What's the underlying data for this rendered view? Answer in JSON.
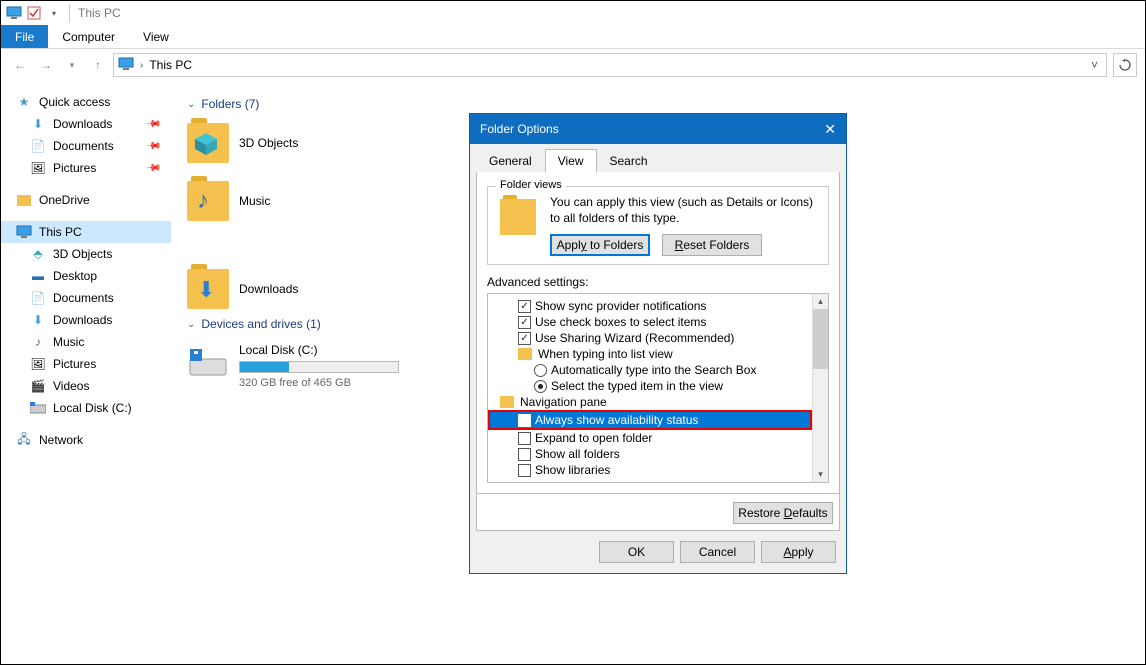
{
  "titlebar": {
    "title": "This PC"
  },
  "ribbon": {
    "file": "File",
    "computer": "Computer",
    "view": "View"
  },
  "address": {
    "text": "This PC"
  },
  "sidebar": {
    "quick": "Quick access",
    "downloads": "Downloads",
    "documents": "Documents",
    "pictures": "Pictures",
    "onedrive": "OneDrive",
    "thispc": "This PC",
    "objects3d": "3D Objects",
    "desktop": "Desktop",
    "docs2": "Documents",
    "dl2": "Downloads",
    "music": "Music",
    "pics2": "Pictures",
    "videos": "Videos",
    "localdisk": "Local Disk (C:)",
    "network": "Network"
  },
  "content": {
    "folders_header": "Folders (7)",
    "drives_header": "Devices and drives (1)",
    "folders": {
      "a": "3D Objects",
      "b": "Music",
      "c": "Downloads"
    },
    "disk": {
      "name": "Local Disk (C:)",
      "free": "320 GB free of 465 GB"
    }
  },
  "dialog": {
    "title": "Folder Options",
    "tabs": {
      "general": "General",
      "view": "View",
      "search": "Search"
    },
    "fv": {
      "legend": "Folder views",
      "desc": "You can apply this view (such as Details or Icons) to all folders of this type.",
      "apply": "Apply to Folders",
      "reset": "Reset Folders"
    },
    "adv_label": "Advanced settings:",
    "adv": {
      "a1": "Show sync provider notifications",
      "a2": "Use check boxes to select items",
      "a3": "Use Sharing Wizard (Recommended)",
      "a4": "When typing into list view",
      "a5": "Automatically type into the Search Box",
      "a6": "Select the typed item in the view",
      "a7": "Navigation pane",
      "a8": "Always show availability status",
      "a9": "Expand to open folder",
      "a10": "Show all folders",
      "a11": "Show libraries"
    },
    "restore": "Restore Defaults",
    "ok": "OK",
    "cancel": "Cancel",
    "applybtn": "Apply"
  }
}
